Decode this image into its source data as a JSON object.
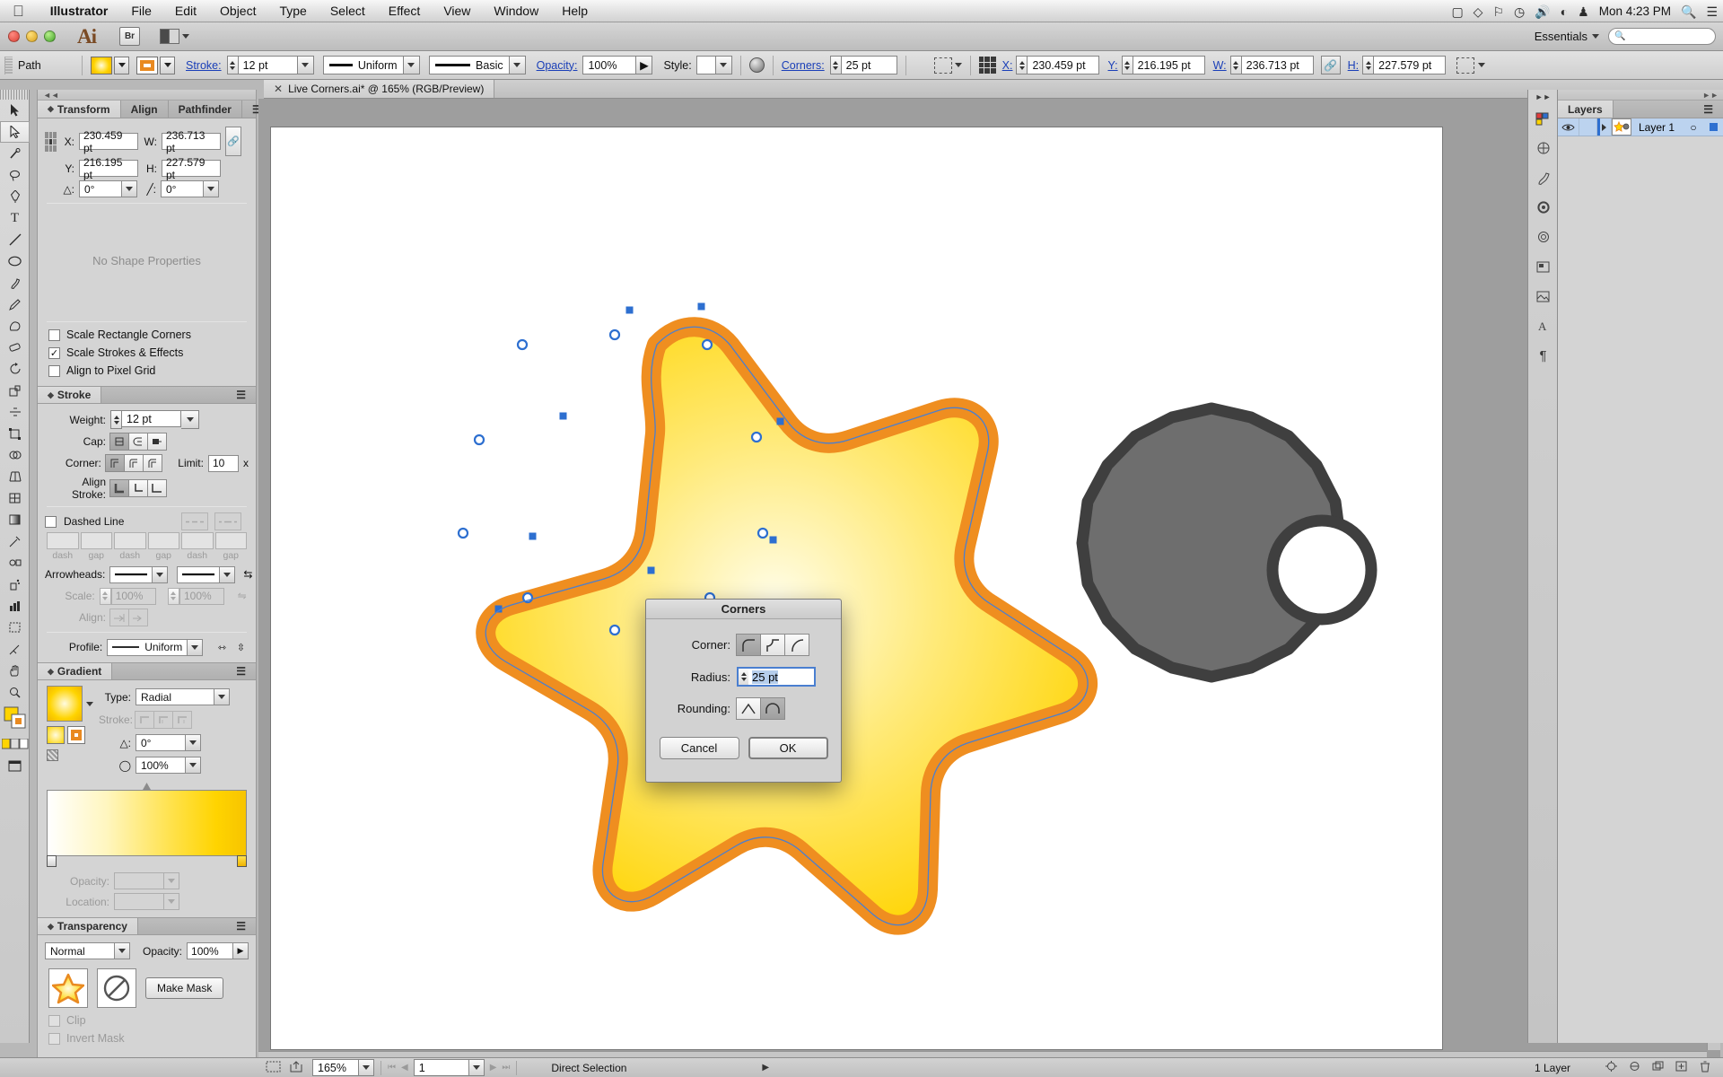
{
  "macmenu": {
    "apple_icon": "apple-icon",
    "items": [
      "Illustrator",
      "File",
      "Edit",
      "Object",
      "Type",
      "Select",
      "Effect",
      "View",
      "Window",
      "Help"
    ],
    "right_icons": [
      "display-icon",
      "dropbox-icon",
      "bluetooth-icon",
      "timemachine-icon",
      "volume-icon",
      "wifi-icon",
      "user-icon",
      "spotlight-icon",
      "menu-icon"
    ],
    "clock": "Mon 4:23 PM"
  },
  "appbar": {
    "logo": "Ai",
    "bridge_label": "Br",
    "workspace_label": "Essentials",
    "search_placeholder": ""
  },
  "controlbar": {
    "object_type": "Path",
    "fill_swatch_name": "fill-swatch",
    "stroke_swatch_name": "stroke-swatch",
    "stroke_label": "Stroke:",
    "stroke_weight": "12 pt",
    "variable_width_profile": "Uniform",
    "brush_definition": "Basic",
    "opacity_label": "Opacity:",
    "opacity_value": "100%",
    "style_label": "Style:",
    "corners_label": "Corners:",
    "corners_value": "25 pt",
    "x_label": "X:",
    "x_value": "230.459 pt",
    "y_label": "Y:",
    "y_value": "216.195 pt",
    "w_label": "W:",
    "w_value": "236.713 pt",
    "h_label": "H:",
    "h_value": "227.579 pt"
  },
  "doctab": {
    "title": "Live Corners.ai* @ 165% (RGB/Preview)",
    "close_icon": "close-icon"
  },
  "tools": [
    "selection-tool",
    "direct-selection-tool",
    "magic-wand-tool",
    "lasso-tool",
    "pen-tool",
    "type-tool",
    "line-segment-tool",
    "ellipse-tool",
    "paintbrush-tool",
    "pencil-tool",
    "blob-brush-tool",
    "eraser-tool",
    "rotate-tool",
    "scale-tool",
    "width-tool",
    "free-transform-tool",
    "shape-builder-tool",
    "perspective-grid-tool",
    "mesh-tool",
    "gradient-tool",
    "eyedropper-tool",
    "blend-tool",
    "symbol-sprayer-tool",
    "column-graph-tool",
    "artboard-tool",
    "slice-tool",
    "hand-tool",
    "zoom-tool",
    "fill-stroke-swatch",
    "color-mode",
    "screen-mode"
  ],
  "transform_panel": {
    "tabs": [
      "Transform",
      "Align",
      "Pathfinder"
    ],
    "active_tab": "Transform",
    "x_label": "X:",
    "x_value": "230.459 pt",
    "y_label": "Y:",
    "y_value": "216.195 pt",
    "w_label": "W:",
    "w_value": "236.713 pt",
    "h_label": "H:",
    "h_value": "227.579 pt",
    "angle_label": "angle-icon",
    "angle_value": "0°",
    "shear_label": "shear-icon",
    "shear_value": "0°",
    "no_shape_properties": "No Shape Properties",
    "checkboxes": [
      {
        "label": "Scale Rectangle Corners",
        "checked": false
      },
      {
        "label": "Scale Strokes & Effects",
        "checked": true
      },
      {
        "label": "Align to Pixel Grid",
        "checked": false
      }
    ]
  },
  "stroke_panel": {
    "title": "Stroke",
    "weight_label": "Weight:",
    "weight_value": "12 pt",
    "cap_label": "Cap:",
    "corner_label": "Corner:",
    "limit_label": "Limit:",
    "limit_value": "10",
    "limit_unit": "x",
    "align_stroke_label": "Align Stroke:",
    "dashed_line_label": "Dashed Line",
    "dashed_line_checked": false,
    "dash_labels": [
      "dash",
      "gap",
      "dash",
      "gap",
      "dash",
      "gap"
    ],
    "arrowheads_label": "Arrowheads:",
    "scale_label": "Scale:",
    "scale_value_1": "100%",
    "scale_value_2": "100%",
    "align_label": "Align:",
    "profile_label": "Profile:",
    "profile_value": "Uniform"
  },
  "gradient_panel": {
    "title": "Gradient",
    "type_label": "Type:",
    "type_value": "Radial",
    "stroke_label": "Stroke:",
    "angle_value": "0°",
    "aspect_value": "100%",
    "opacity_label": "Opacity:",
    "opacity_value": "",
    "location_label": "Location:",
    "location_value": ""
  },
  "transparency_panel": {
    "title": "Transparency",
    "blend_mode": "Normal",
    "opacity_label": "Opacity:",
    "opacity_value": "100%",
    "make_mask_label": "Make Mask",
    "clip_label": "Clip",
    "clip_checked": false,
    "invert_mask_label": "Invert Mask",
    "invert_mask_checked": false
  },
  "layers_panel": {
    "title": "Layers",
    "menu_icon": "panel-menu-icon",
    "rows": [
      {
        "name": "Layer 1",
        "visible": true,
        "locked": false,
        "target_icon": "target-icon",
        "selected_color": "#2d6fd0"
      }
    ],
    "footer_count": "1 Layer",
    "footer_icons": [
      "locate-object-icon",
      "make-clipping-mask-icon",
      "create-new-sublayer-icon",
      "create-new-layer-icon",
      "delete-selection-icon"
    ]
  },
  "right_icon_rail": [
    "color-panel-icon",
    "color-guide-icon",
    "brushes-icon",
    "symbols-icon",
    "appearance-icon",
    "artboards-icon",
    "links-icon",
    "character-icon",
    "paragraph-icon"
  ],
  "dialog": {
    "title": "Corners",
    "corner_label": "Corner:",
    "corner_options": [
      "round-corner-icon",
      "inverted-round-corner-icon",
      "chamfer-corner-icon"
    ],
    "corner_selected_index": 0,
    "radius_label": "Radius:",
    "radius_value": "25 pt",
    "rounding_label": "Rounding:",
    "rounding_options": [
      "relative-rounding-icon",
      "absolute-rounding-icon"
    ],
    "rounding_selected_index": 1,
    "cancel_label": "Cancel",
    "ok_label": "OK"
  },
  "statusbar": {
    "zoom_value": "165%",
    "page_value": "1",
    "tool_status": "Direct Selection",
    "layer_count": "1 Layer"
  },
  "canvas": {
    "star_fill_outer": "#e98a21",
    "star_fill_inner": "#ffd400",
    "gear_fill": "#6e6e6e",
    "gear_stroke": "#4a4a4a",
    "selection_color": "#2d6fd0"
  }
}
